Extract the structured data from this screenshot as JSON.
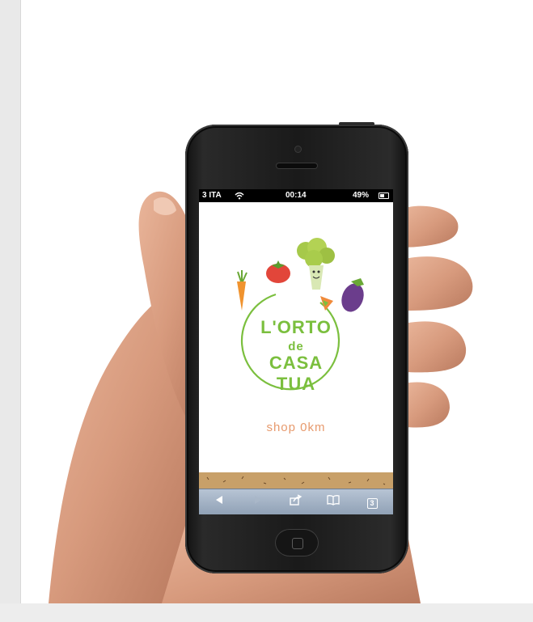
{
  "statusbar": {
    "carrier": "3 ITA",
    "time": "00:14",
    "battery": "49%"
  },
  "site": {
    "logo_line1": "L'ORTO",
    "logo_line2": "de",
    "logo_line3": "CASA",
    "logo_line4": "TUA",
    "tagline": "shop 0km"
  },
  "browser_toolbar": {
    "back_icon": "back-arrow",
    "forward_icon": "forward-arrow",
    "share_icon": "share",
    "bookmarks_icon": "book",
    "tabs_count": "3"
  },
  "colors": {
    "logo_green": "#7bbf3e",
    "tagline_orange": "#e79a6d",
    "soil": "#c8a069",
    "toolbar_blue": "#8fa0b5"
  }
}
